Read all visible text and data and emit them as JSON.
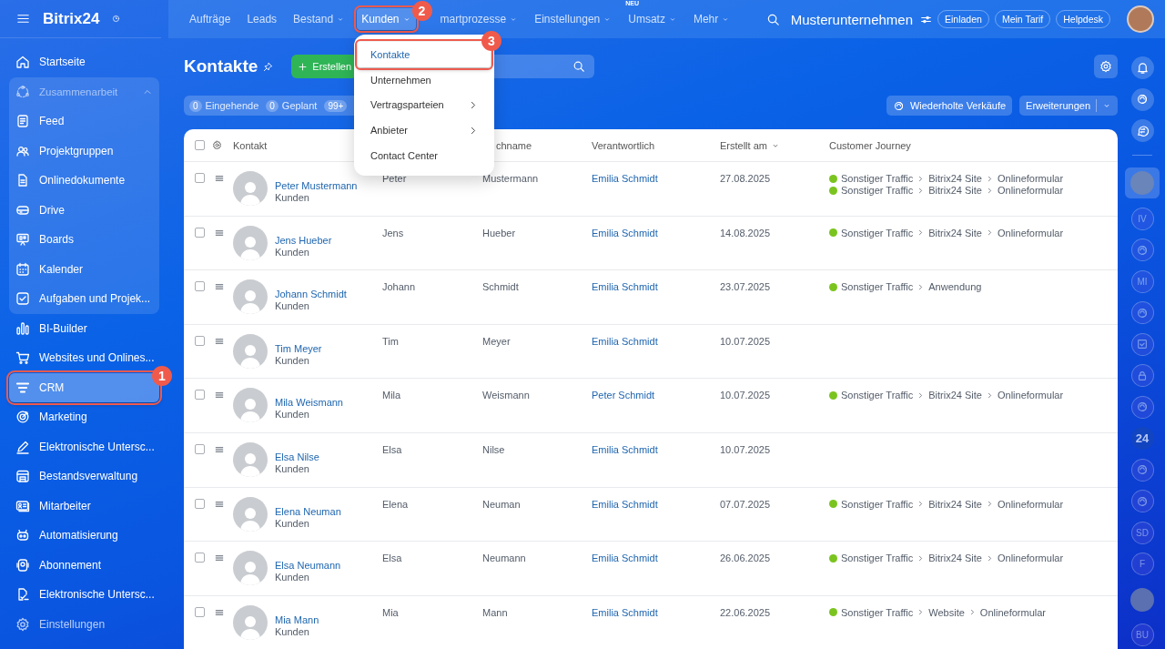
{
  "logo": {
    "text": "Bitrix24"
  },
  "nav": [
    {
      "label": "Aufträge",
      "dropdown": false,
      "selected": false
    },
    {
      "label": "Leads",
      "dropdown": false,
      "selected": false
    },
    {
      "label": "Bestand",
      "dropdown": true,
      "selected": false
    },
    {
      "label": "Kunden",
      "dropdown": true,
      "selected": true,
      "callout": "2"
    },
    {
      "label": "martprozesse",
      "dropdown": true,
      "selected": false
    },
    {
      "label": "Einstellungen",
      "dropdown": true,
      "selected": false
    },
    {
      "label": "Umsatz",
      "dropdown": true,
      "selected": false,
      "badge": "NEU"
    },
    {
      "label": "Mehr",
      "dropdown": true,
      "selected": false
    }
  ],
  "company": "Musterunternehmen",
  "header_buttons": [
    "Einladen",
    "Mein Tarif",
    "Helpdesk"
  ],
  "sidebar": [
    {
      "kind": "item",
      "label": "Startseite",
      "selected": false
    },
    {
      "kind": "group",
      "label": "Zusammenarbeit",
      "expanded": true,
      "children": [
        {
          "label": "Feed",
          "selected": false
        },
        {
          "label": "Projektgruppen",
          "selected": false
        },
        {
          "label": "Onlinedokumente",
          "selected": false
        },
        {
          "label": "Drive",
          "selected": false
        },
        {
          "label": "Boards",
          "selected": false
        },
        {
          "label": "Kalender",
          "selected": false
        },
        {
          "label": "Aufgaben und Projek...",
          "selected": false
        }
      ]
    },
    {
      "kind": "item",
      "label": "BI-Builder",
      "selected": false
    },
    {
      "kind": "item",
      "label": "Websites und Onlines...",
      "selected": false
    },
    {
      "kind": "item",
      "label": "CRM",
      "selected": true,
      "callout": "1"
    },
    {
      "kind": "item",
      "label": "Marketing",
      "selected": false
    },
    {
      "kind": "item",
      "label": "Elektronische Untersc...",
      "selected": false
    },
    {
      "kind": "item",
      "label": "Bestandsverwaltung",
      "selected": false
    },
    {
      "kind": "item",
      "label": "Mitarbeiter",
      "selected": false
    },
    {
      "kind": "item",
      "label": "Automatisierung",
      "selected": false
    },
    {
      "kind": "item",
      "label": "Abonnement",
      "selected": false
    },
    {
      "kind": "item",
      "label": "Elektronische Untersc...",
      "selected": false
    },
    {
      "kind": "item",
      "label": "Einstellungen",
      "selected": false
    }
  ],
  "page_title": "Kontakte",
  "create_button": "Erstellen",
  "counters": [
    {
      "count": "0",
      "label": "Eingehende"
    },
    {
      "count": "0",
      "label": "Geplant"
    },
    {
      "count": "99+"
    }
  ],
  "toolbar_buttons": [
    {
      "label": "Wiederholte Verkäufe",
      "kind": "icon"
    },
    {
      "label": "Erweiterungen",
      "kind": "split"
    }
  ],
  "menu": [
    {
      "label": "Kontakte",
      "selected": true,
      "submenu": false,
      "callout": "3"
    },
    {
      "label": "Unternehmen",
      "selected": false,
      "submenu": false
    },
    {
      "label": "Vertragsparteien",
      "selected": false,
      "submenu": true
    },
    {
      "label": "Anbieter",
      "selected": false,
      "submenu": true
    },
    {
      "label": "Contact Center",
      "selected": false,
      "submenu": false
    }
  ],
  "table": {
    "all_checked": false,
    "columns": [
      {
        "label": "Kontakt",
        "sorted": false
      },
      {
        "label": "chname",
        "sorted": false
      },
      {
        "label": "Verantwortlich",
        "sorted": false
      },
      {
        "label": "Erstellt am",
        "sorted": true
      },
      {
        "label": "Customer Journey",
        "sorted": false
      }
    ],
    "rows": [
      {
        "name": "Peter Mustermann",
        "type": "Kunden",
        "first": "Peter",
        "last": "Mustermann",
        "owner": "Emilia Schmidt",
        "created": "27.08.2025",
        "journey": [
          [
            "Sonstiger Traffic",
            "Bitrix24 Site",
            "Onlineformular"
          ],
          [
            "Sonstiger Traffic",
            "Bitrix24 Site",
            "Onlineformular"
          ]
        ],
        "checked": false
      },
      {
        "name": "Jens Hueber",
        "type": "Kunden",
        "first": "Jens",
        "last": "Hueber",
        "owner": "Emilia Schmidt",
        "created": "14.08.2025",
        "journey": [
          [
            "Sonstiger Traffic",
            "Bitrix24 Site",
            "Onlineformular"
          ]
        ],
        "checked": false
      },
      {
        "name": "Johann Schmidt",
        "type": "Kunden",
        "first": "Johann",
        "last": "Schmidt",
        "owner": "Emilia Schmidt",
        "created": "23.07.2025",
        "journey": [
          [
            "Sonstiger Traffic",
            "Anwendung"
          ]
        ],
        "checked": false
      },
      {
        "name": "Tim Meyer",
        "type": "Kunden",
        "first": "Tim",
        "last": "Meyer",
        "owner": "Emilia Schmidt",
        "created": "10.07.2025",
        "journey": [],
        "checked": false
      },
      {
        "name": "Mila Weismann",
        "type": "Kunden",
        "first": "Mila",
        "last": "Weismann",
        "owner": "Peter Schmidt",
        "created": "10.07.2025",
        "journey": [
          [
            "Sonstiger Traffic",
            "Bitrix24 Site",
            "Onlineformular"
          ]
        ],
        "checked": false
      },
      {
        "name": "Elsa Nilse",
        "type": "Kunden",
        "first": "Elsa",
        "last": "Nilse",
        "owner": "Emilia Schmidt",
        "created": "10.07.2025",
        "journey": [],
        "checked": false
      },
      {
        "name": "Elena Neuman",
        "type": "Kunden",
        "first": "Elena",
        "last": "Neuman",
        "owner": "Emilia Schmidt",
        "created": "07.07.2025",
        "journey": [
          [
            "Sonstiger Traffic",
            "Bitrix24 Site",
            "Onlineformular"
          ]
        ],
        "checked": false
      },
      {
        "name": "Elsa Neumann",
        "type": "Kunden",
        "first": "Elsa",
        "last": "Neumann",
        "owner": "Emilia Schmidt",
        "created": "26.06.2025",
        "journey": [
          [
            "Sonstiger Traffic",
            "Bitrix24 Site",
            "Onlineformular"
          ]
        ],
        "checked": false
      },
      {
        "name": "Mia Mann",
        "type": "Kunden",
        "first": "Mia",
        "last": "Mann",
        "owner": "Emilia Schmidt",
        "created": "22.06.2025",
        "journey": [
          [
            "Sonstiger Traffic",
            "Website",
            "Onlineformular"
          ]
        ],
        "checked": false
      }
    ]
  },
  "rail": [
    {
      "kind": "bell"
    },
    {
      "kind": "logo"
    },
    {
      "kind": "chat"
    },
    {
      "kind": "avatar",
      "selected": true
    },
    {
      "kind": "initials",
      "text": "IV"
    },
    {
      "kind": "logo"
    },
    {
      "kind": "initials",
      "text": "MI"
    },
    {
      "kind": "logo"
    },
    {
      "kind": "task"
    },
    {
      "kind": "lock"
    },
    {
      "kind": "logo"
    },
    {
      "kind": "number",
      "text": "24"
    },
    {
      "kind": "logo"
    },
    {
      "kind": "logo"
    },
    {
      "kind": "initials",
      "text": "SD"
    },
    {
      "kind": "initials",
      "text": "F"
    },
    {
      "kind": "avatar",
      "selected": false
    },
    {
      "kind": "initials",
      "text": "BU"
    }
  ]
}
